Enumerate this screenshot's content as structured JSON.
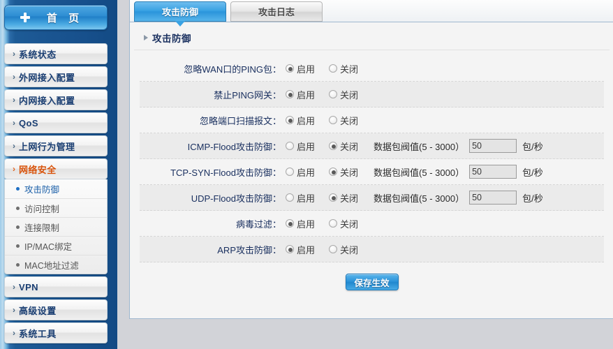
{
  "sidebar": {
    "home": {
      "label": "首 页",
      "icon": "plus-icon"
    },
    "items": [
      {
        "label": "系统状态",
        "active": false
      },
      {
        "label": "外网接入配置",
        "active": false
      },
      {
        "label": "内网接入配置",
        "active": false
      },
      {
        "label": "QoS",
        "active": false
      },
      {
        "label": "上网行为管理",
        "active": false
      },
      {
        "label": "网络安全",
        "active": true
      },
      {
        "label": "VPN",
        "active": false
      },
      {
        "label": "高级设置",
        "active": false
      },
      {
        "label": "系统工具",
        "active": false
      }
    ],
    "sub_items": [
      {
        "label": "攻击防御",
        "active": true
      },
      {
        "label": "访问控制",
        "active": false
      },
      {
        "label": "连接限制",
        "active": false
      },
      {
        "label": "IP/MAC绑定",
        "active": false
      },
      {
        "label": "MAC地址过滤",
        "active": false
      }
    ]
  },
  "main": {
    "tabs": [
      {
        "label": "攻击防御",
        "active": true
      },
      {
        "label": "攻击日志",
        "active": false
      }
    ],
    "section_title": "攻击防御",
    "enable_label": "启用",
    "disable_label": "关闭",
    "threshold_label": "数据包阀值(5 - 3000）",
    "threshold_unit": "包/秒",
    "rows": [
      {
        "label": "忽略WAN口的PING包：",
        "selected": "enable",
        "has_threshold": false
      },
      {
        "label": "禁止PING网关：",
        "selected": "enable",
        "has_threshold": false
      },
      {
        "label": "忽略端口扫描报文：",
        "selected": "enable",
        "has_threshold": false
      },
      {
        "label": "ICMP-Flood攻击防御：",
        "selected": "disable",
        "has_threshold": true,
        "threshold_value": "50"
      },
      {
        "label": "TCP-SYN-Flood攻击防御：",
        "selected": "disable",
        "has_threshold": true,
        "threshold_value": "50"
      },
      {
        "label": "UDP-Flood攻击防御：",
        "selected": "disable",
        "has_threshold": true,
        "threshold_value": "50"
      },
      {
        "label": "病毒过滤：",
        "selected": "enable",
        "has_threshold": false
      },
      {
        "label": "ARP攻击防御：",
        "selected": "enable",
        "has_threshold": false
      }
    ],
    "save_label": "保存生效"
  },
  "colors": {
    "sidebar_blue": "#17508c",
    "accent_blue": "#2b95db",
    "active_orange": "#d9530b",
    "label_navy": "#1b3160"
  }
}
